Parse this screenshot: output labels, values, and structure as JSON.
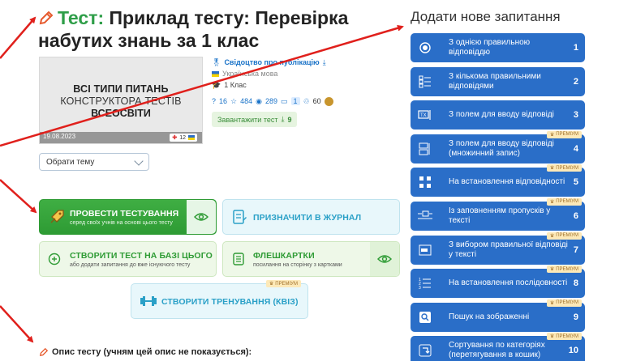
{
  "page": {
    "title_prefix": "Тест:",
    "title": "Приклад тесту: Перевірка набутих знань за 1 клас"
  },
  "thumbnail": {
    "line1": "ВСІ ТИПИ ПИТАНЬ",
    "line2": "КОНСТРУКТОРА ТЕСТІВ",
    "line3": "ВСЕОСВІТИ",
    "date": "19.08.2023",
    "badge_count": "12"
  },
  "meta": {
    "certificate": "Свідоцтво про публікацію",
    "language": "Українська мова",
    "grade": "1 Клас",
    "stats": {
      "questions": "16",
      "rating": "484",
      "views": "289",
      "comments": "1",
      "likes": "60"
    },
    "download_label": "Завантажити тест",
    "download_count": "9"
  },
  "topic_select": {
    "placeholder": "Обрати тему"
  },
  "actions": {
    "run": {
      "label": "ПРОВЕСТИ ТЕСТУВАННЯ",
      "sub": "серед своїх учнів на основі цього тесту"
    },
    "journal": {
      "label": "ПРИЗНАЧИТИ В ЖУРНАЛ"
    },
    "create": {
      "label": "СТВОРИТИ ТЕСТ НА БАЗІ ЦЬОГО",
      "sub": "або додати запитання до вже існуючого тесту"
    },
    "flash": {
      "label": "ФЛЕШКАРТКИ",
      "sub": "посилання на сторінку з картками"
    },
    "quiz": {
      "label": "СТВОРИТИ ТРЕНУВАННЯ (КВІЗ)",
      "premium": "ПРЕМІУМ"
    }
  },
  "description": {
    "label": "Опис тесту (учням цей опис не показується):"
  },
  "panel": {
    "title": "Додати нове запитання",
    "premium_label": "ПРЕМІУМ",
    "items": [
      {
        "label": "З однією правильною відповіддю",
        "num": "1",
        "icon": "radio-icon",
        "premium": false
      },
      {
        "label": "З кількома правильними відповідями",
        "num": "2",
        "icon": "checkbox-list-icon",
        "premium": false
      },
      {
        "label": "З полем для вводу відповіді",
        "num": "3",
        "icon": "text-field-icon",
        "premium": false
      },
      {
        "label": "З полем для вводу відповіді (множинний запис)",
        "num": "4",
        "icon": "multi-field-icon",
        "premium": true
      },
      {
        "label": "На встановлення відповідності",
        "num": "5",
        "icon": "matching-icon",
        "premium": true
      },
      {
        "label": "Із заповненням пропусків у тексті",
        "num": "6",
        "icon": "fill-gaps-icon",
        "premium": true
      },
      {
        "label": "З вибором правильної відповіді у тексті",
        "num": "7",
        "icon": "select-in-text-icon",
        "premium": true
      },
      {
        "label": "На встановлення послідовності",
        "num": "8",
        "icon": "sequence-icon",
        "premium": true
      },
      {
        "label": "Пошук на зображенні",
        "num": "9",
        "icon": "image-search-icon",
        "premium": true
      },
      {
        "label": "Сортування по категоріях (перетягування в кошик)",
        "num": "10",
        "icon": "sorting-icon",
        "premium": true
      }
    ]
  },
  "colors": {
    "accent_green": "#2e9b34",
    "accent_blue": "#2a6ec8",
    "annotation_red": "#e0201c"
  }
}
